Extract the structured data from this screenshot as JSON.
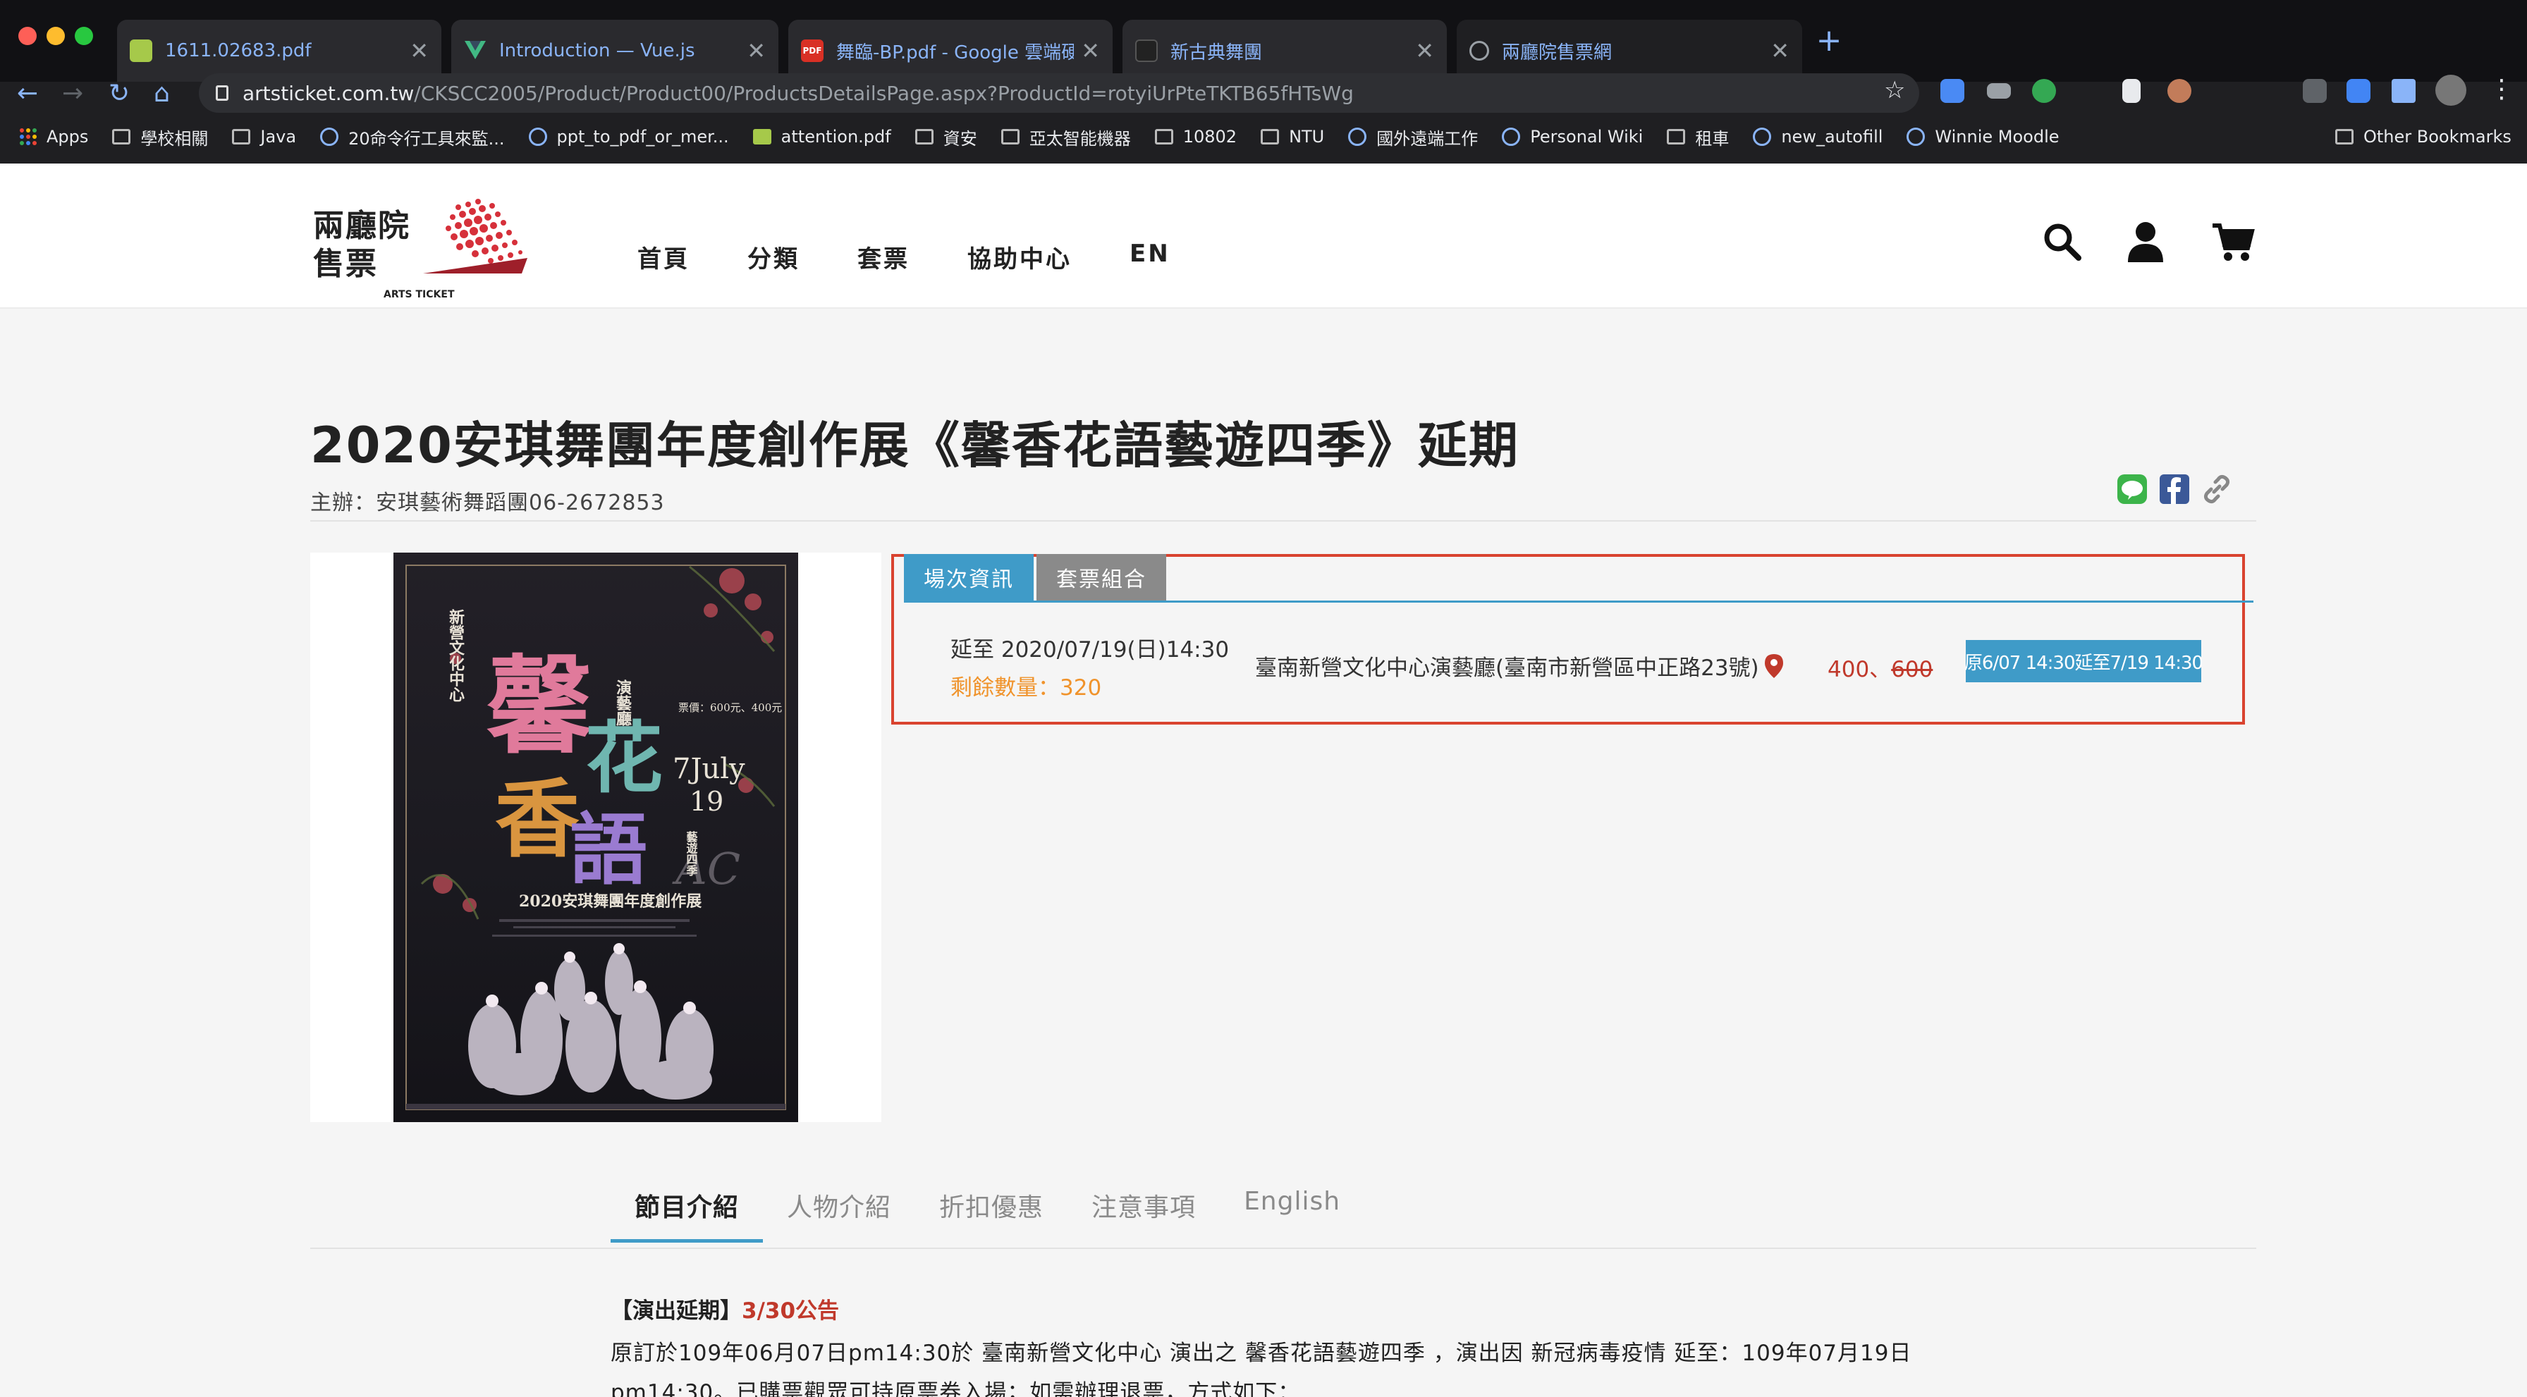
{
  "browser": {
    "tabs": [
      {
        "title": "1611.02683.pdf",
        "favicon": "pdf-icon"
      },
      {
        "title": "Introduction — Vue.js",
        "favicon": "vue-icon"
      },
      {
        "title": "舞臨-BP.pdf - Google 雲端硬碟",
        "favicon": "pdf-icon"
      },
      {
        "title": "新古典舞團",
        "favicon": "site-icon"
      },
      {
        "title": "兩廳院售票網",
        "favicon": "globe-icon"
      }
    ],
    "url_host": "artsticket.com.tw",
    "url_path": "/CKSCC2005/Product/Product00/ProductsDetailsPage.aspx?ProductId=rotyiUrPteTKTB65fHTsWg",
    "bookmarks": [
      "Apps",
      "學校相關",
      "Java",
      "20命令行工具來監...",
      "ppt_to_pdf_or_mer...",
      "attention.pdf",
      "資安",
      "亞太智能機器",
      "10802",
      "NTU",
      "國外遠端工作",
      "Personal Wiki",
      "租車",
      "new_autofill",
      "Winnie Moodle"
    ],
    "other_bookmarks": "Other Bookmarks"
  },
  "site": {
    "logo_line1": "兩廳院",
    "logo_line2": "售票",
    "logo_sub": "ARTS TICKET",
    "nav": [
      "首頁",
      "分類",
      "套票",
      "協助中心",
      "EN"
    ]
  },
  "product": {
    "title": "2020安琪舞團年度創作展《馨香花語藝遊四季》延期",
    "organizer": "主辦：安琪藝術舞蹈團06-2672853"
  },
  "session": {
    "tabs": [
      "場次資訊",
      "套票組合"
    ],
    "date": "延至 2020/07/19(日)14:30",
    "remaining": "剩餘數量：320",
    "venue": "臺南新營文化中心演藝廳(臺南市新營區中正路23號)",
    "price_active": "400",
    "price_sep": "、",
    "price_sold": "600",
    "button": "原6/07 14:30延至7/19 14:30"
  },
  "detail_tabs": [
    "節目介紹",
    "人物介紹",
    "折扣優惠",
    "注意事項",
    "English"
  ],
  "notice": {
    "heading": "【演出延期】",
    "heading_date": "3/30公告",
    "line1": "原訂於109年06月07日pm14:30於 臺南新營文化中心 演出之 馨香花語藝遊四季 ，演出因 新冠病毒疫情 延至：109年07月19日",
    "line2": "pm14:30。已購票觀眾可持原票券入場；如需辦理退票，方式如下："
  },
  "poster": {
    "venue_vertical": "新營文化中心",
    "hall_vertical": "演藝廳",
    "title_chars": [
      "馨",
      "花",
      "香",
      "語"
    ],
    "date_month": "7July",
    "date_day": "19",
    "price": "票價：600元、400元",
    "series": "藝遊四季",
    "event": "2020安琪舞團年度創作展",
    "monogram": "AC"
  },
  "colors": {
    "accent_blue": "#3f9bc8",
    "highlight_red": "#d9432f",
    "price_red": "#c0392b",
    "remain_orange": "#f0932b"
  }
}
